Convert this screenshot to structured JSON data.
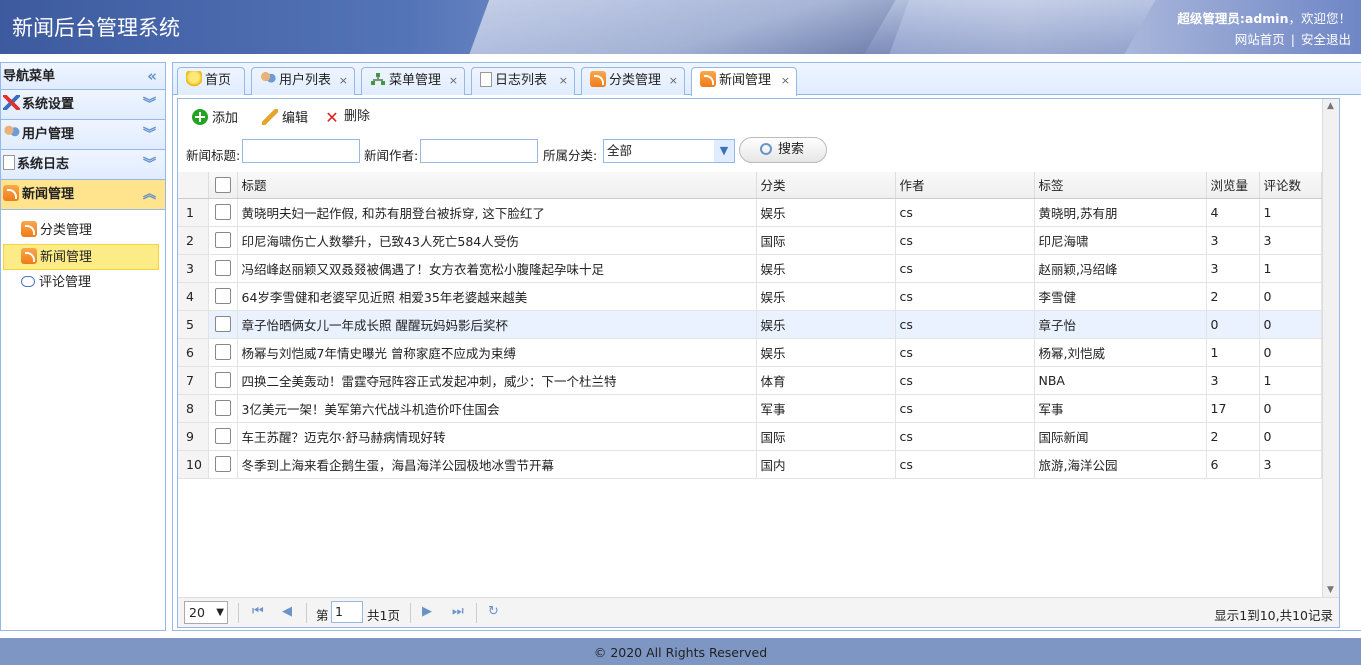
{
  "header": {
    "title": "新闻后台管理系统",
    "welcome_user": "超级管理员:admin",
    "welcome_text": "，欢迎您！",
    "link_home": "网站首页",
    "link_sep": "|",
    "link_logout": "安全退出"
  },
  "sidebar": {
    "title": "导航菜单",
    "collapse_glyph": "«",
    "groups": [
      {
        "label": "系统设置"
      },
      {
        "label": "用户管理"
      },
      {
        "label": "系统日志"
      },
      {
        "label": "新闻管理"
      }
    ],
    "sub_items": [
      {
        "label": "分类管理"
      },
      {
        "label": "新闻管理"
      },
      {
        "label": "评论管理"
      }
    ]
  },
  "tabs": [
    {
      "label": "首页"
    },
    {
      "label": "用户列表"
    },
    {
      "label": "菜单管理"
    },
    {
      "label": "日志列表"
    },
    {
      "label": "分类管理"
    },
    {
      "label": "新闻管理"
    }
  ],
  "tab_close": "×",
  "toolbar": {
    "add": "添加",
    "edit": "编辑",
    "delete": "删除"
  },
  "search": {
    "title_label": "新闻标题:",
    "author_label": "新闻作者:",
    "category_label": "所属分类:",
    "category_value": "全部",
    "search_button": "搜索"
  },
  "grid": {
    "columns": {
      "title": "标题",
      "category": "分类",
      "author": "作者",
      "tags": "标签",
      "views": "浏览量",
      "comments": "评论数"
    },
    "rows": [
      {
        "n": "1",
        "title": "黄晓明夫妇一起作假, 和苏有朋登台被拆穿, 这下脸红了",
        "category": "娱乐",
        "author": "cs",
        "tags": "黄晓明,苏有朋",
        "views": "4",
        "comments": "1"
      },
      {
        "n": "2",
        "title": "印尼海啸伤亡人数攀升，已致43人死亡584人受伤",
        "category": "国际",
        "author": "cs",
        "tags": "印尼海啸",
        "views": "3",
        "comments": "3"
      },
      {
        "n": "3",
        "title": "冯绍峰赵丽颖又双叒叕被偶遇了！女方衣着宽松小腹隆起孕味十足",
        "category": "娱乐",
        "author": "cs",
        "tags": "赵丽颖,冯绍峰",
        "views": "3",
        "comments": "1"
      },
      {
        "n": "4",
        "title": "64岁李雪健和老婆罕见近照 相爱35年老婆越来越美",
        "category": "娱乐",
        "author": "cs",
        "tags": "李雪健",
        "views": "2",
        "comments": "0"
      },
      {
        "n": "5",
        "title": "章子怡晒俩女儿一年成长照 醒醒玩妈妈影后奖杯",
        "category": "娱乐",
        "author": "cs",
        "tags": "章子怡",
        "views": "0",
        "comments": "0"
      },
      {
        "n": "6",
        "title": "杨幂与刘恺威7年情史曝光 曾称家庭不应成为束缚",
        "category": "娱乐",
        "author": "cs",
        "tags": "杨幂,刘恺威",
        "views": "1",
        "comments": "0"
      },
      {
        "n": "7",
        "title": "四换二全美轰动！雷霆夺冠阵容正式发起冲刺，威少：下一个杜兰特",
        "category": "体育",
        "author": "cs",
        "tags": "NBA",
        "views": "3",
        "comments": "1"
      },
      {
        "n": "8",
        "title": "3亿美元一架！美军第六代战斗机造价吓住国会",
        "category": "军事",
        "author": "cs",
        "tags": "军事",
        "views": "17",
        "comments": "0"
      },
      {
        "n": "9",
        "title": "车王苏醒？迈克尔·舒马赫病情现好转",
        "category": "国际",
        "author": "cs",
        "tags": "国际新闻",
        "views": "2",
        "comments": "0"
      },
      {
        "n": "10",
        "title": "冬季到上海来看企鹅生蛋，海昌海洋公园极地冰雪节开幕",
        "category": "国内",
        "author": "cs",
        "tags": "旅游,海洋公园",
        "views": "6",
        "comments": "3"
      }
    ]
  },
  "pager": {
    "page_size": "20",
    "page_prefix": "第",
    "page_value": "1",
    "page_total": "共1页",
    "info": "显示1到10,共10记录"
  },
  "footer": {
    "text": "© 2020 All Rights Reserved"
  }
}
